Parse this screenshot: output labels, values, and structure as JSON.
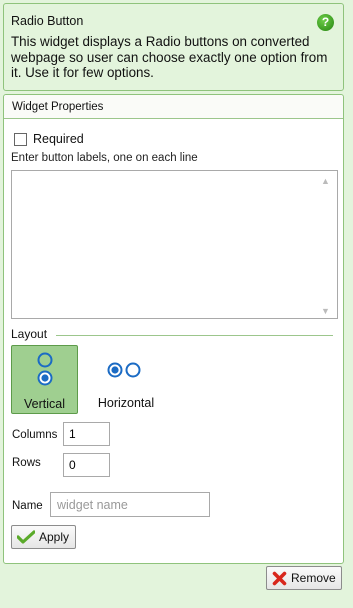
{
  "info": {
    "title": "Radio Button",
    "help_icon": "?",
    "description": "This widget displays a Radio buttons on converted webpage so user can choose exactly one option from it. Use it for few options."
  },
  "properties": {
    "header": "Widget Properties",
    "required_label": "Required",
    "required_checked": false,
    "labels_caption": "Enter button labels, one on each line",
    "labels_value": "",
    "layout_legend": "Layout",
    "layout_options": [
      {
        "label": "Vertical",
        "selected": true
      },
      {
        "label": "Horizontal",
        "selected": false
      }
    ],
    "columns_label": "Columns",
    "columns_value": "1",
    "rows_label": "Rows",
    "rows_value": "0",
    "name_label": "Name",
    "name_placeholder": "widget name",
    "apply_label": "Apply"
  },
  "footer": {
    "remove_label": "Remove"
  },
  "colors": {
    "panel_background": "#e3f4dc",
    "panel_border": "#8fc37c",
    "selected_layout": "#9fcf90",
    "radio_blue": "#1b6bc4",
    "remove_icon_red": "#d8261c",
    "apply_icon_green": "#5aaa2a"
  }
}
